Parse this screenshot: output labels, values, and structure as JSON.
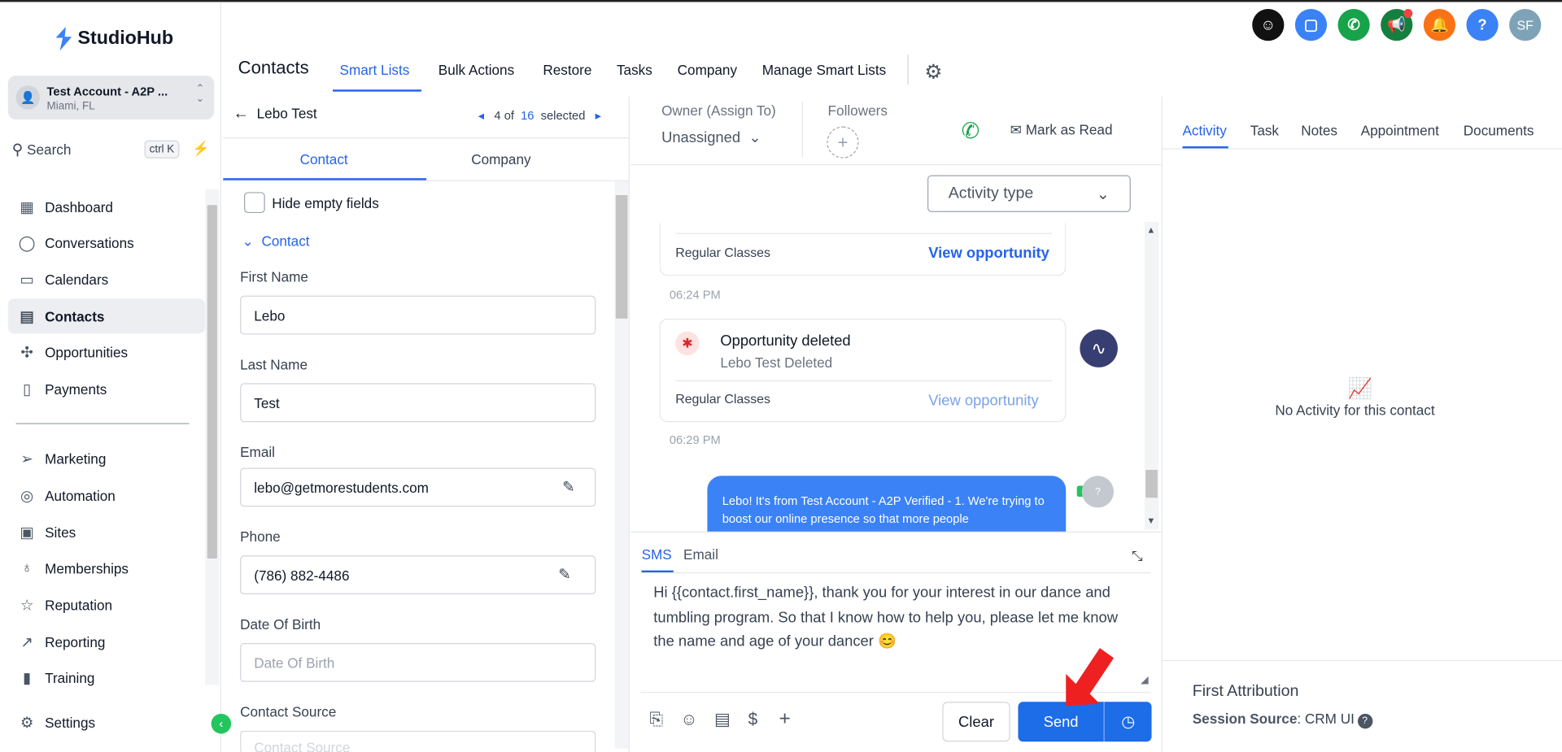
{
  "brand": {
    "name": "StudioHub"
  },
  "account": {
    "name": "Test Account - A2P ...",
    "location": "Miami, FL"
  },
  "search": {
    "label": "Search",
    "shortcut": "ctrl K"
  },
  "nav": [
    {
      "label": "Dashboard",
      "icon": "dashboard-icon"
    },
    {
      "label": "Conversations",
      "icon": "chat-icon"
    },
    {
      "label": "Calendars",
      "icon": "calendar-icon"
    },
    {
      "label": "Contacts",
      "icon": "contacts-icon",
      "active": true
    },
    {
      "label": "Opportunities",
      "icon": "opportunities-icon"
    },
    {
      "label": "Payments",
      "icon": "payments-icon"
    },
    {
      "label": "Marketing",
      "icon": "send-icon"
    },
    {
      "label": "Automation",
      "icon": "automation-icon"
    },
    {
      "label": "Sites",
      "icon": "sites-icon"
    },
    {
      "label": "Memberships",
      "icon": "memberships-icon"
    },
    {
      "label": "Reputation",
      "icon": "star-icon"
    },
    {
      "label": "Reporting",
      "icon": "trend-icon"
    },
    {
      "label": "Training",
      "icon": "book-icon"
    },
    {
      "label": "Settings",
      "icon": "gear-icon"
    }
  ],
  "header": {
    "title": "Contacts",
    "tabs": [
      "Smart Lists",
      "Bulk Actions",
      "Restore",
      "Tasks",
      "Company",
      "Manage Smart Lists"
    ],
    "avatar": "SF",
    "help": "?"
  },
  "contact_panel": {
    "back_label": "Lebo Test",
    "pager": {
      "current": "4",
      "of": "of",
      "total": "16",
      "suffix": "selected"
    },
    "tabs": [
      "Contact",
      "Company"
    ],
    "hide_empty": "Hide empty fields",
    "section": "Contact",
    "fields": {
      "first_name": {
        "label": "First Name",
        "value": "Lebo"
      },
      "last_name": {
        "label": "Last Name",
        "value": "Test"
      },
      "email": {
        "label": "Email",
        "value": "lebo@getmorestudents.com"
      },
      "phone": {
        "label": "Phone",
        "value": "(786) 882-4486"
      },
      "dob": {
        "label": "Date Of Birth",
        "placeholder": "Date Of Birth"
      },
      "source": {
        "label": "Contact Source",
        "placeholder": "Contact Source"
      }
    }
  },
  "conversation": {
    "owner_label": "Owner (Assign To)",
    "owner_value": "Unassigned",
    "followers_label": "Followers",
    "mark_read": "Mark as Read",
    "activity_type": "Activity type",
    "card1": {
      "footer": "Regular Classes",
      "link": "View opportunity"
    },
    "time1": "06:24 PM",
    "card2": {
      "title": "Opportunity deleted",
      "subtitle": "Lebo Test Deleted",
      "footer": "Regular Classes",
      "link": "View opportunity"
    },
    "time2": "06:29 PM",
    "bubble": "Lebo! It's  from Test Account - A2P Verified - 1. We're trying to boost our online presence so that more people",
    "compose_tabs": [
      "SMS",
      "Email"
    ],
    "compose_text": "Hi {{contact.first_name}}, thank you for your interest in our dance and tumbling program. So that I know how to help you, please let me know the name and age of your dancer 😊",
    "clear": "Clear",
    "send": "Send"
  },
  "right_panel": {
    "tabs": [
      "Activity",
      "Task",
      "Notes",
      "Appointment",
      "Documents"
    ],
    "empty": "No Activity for this contact",
    "first_attribution": "First Attribution",
    "session_source_label": "Session Source",
    "session_source_value": "CRM UI"
  },
  "colors": {
    "accent": "#2563eb",
    "send": "#1d6ce8",
    "green": "#22c55e"
  }
}
